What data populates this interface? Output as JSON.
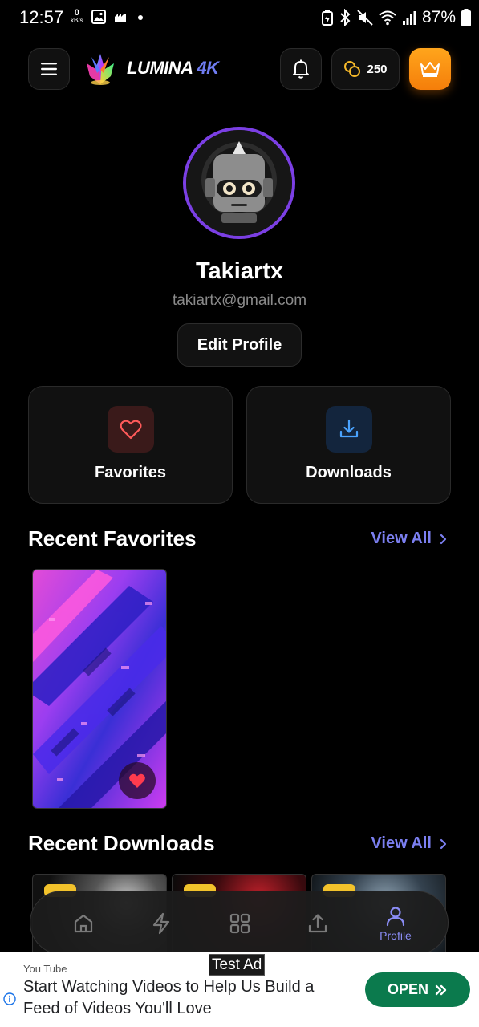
{
  "status_bar": {
    "time": "12:57",
    "net_speed_value": "0",
    "net_speed_unit": "kB/s",
    "battery": "87%"
  },
  "header": {
    "brand_main": "LUMINA",
    "brand_accent": "4K",
    "coins": "250",
    "icons": [
      "menu-icon",
      "bell-icon",
      "coins-icon",
      "crown-icon"
    ]
  },
  "profile": {
    "username": "Takiartx",
    "email": "takiartx@gmail.com",
    "edit_label": "Edit Profile"
  },
  "cards": {
    "favorites_label": "Favorites",
    "downloads_label": "Downloads"
  },
  "recent_favorites": {
    "title": "Recent Favorites",
    "view_all": "View All"
  },
  "recent_downloads": {
    "title": "Recent Downloads",
    "view_all": "View All"
  },
  "bottom_nav": {
    "items": [
      "home-icon",
      "bolt-icon",
      "grid-icon",
      "upload-icon",
      "profile-icon"
    ],
    "active_label": "Profile"
  },
  "ad": {
    "label": "Test Ad",
    "source": "You Tube",
    "text": "Start Watching Videos to Help Us Build a Feed of Videos You'll Love",
    "button": "OPEN"
  },
  "colors": {
    "accent": "#7b7ff0",
    "avatar_ring": "#7b3fe4",
    "premium": "#f5930f",
    "ad_button": "#0b7a4d"
  }
}
